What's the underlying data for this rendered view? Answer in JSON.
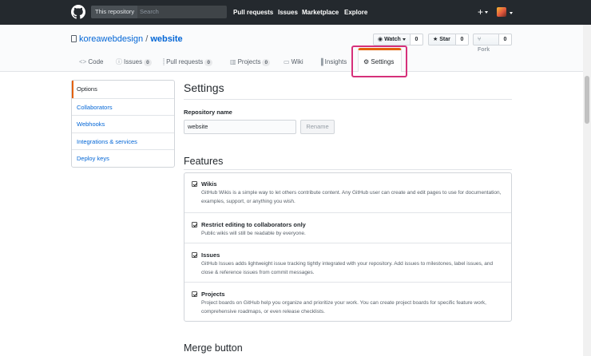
{
  "header": {
    "scope_label": "This repository",
    "search_placeholder": "Search",
    "nav": [
      "Pull requests",
      "Issues",
      "Marketplace",
      "Explore"
    ],
    "plus": "+"
  },
  "repo": {
    "owner": "koreawebdesign",
    "separator": "/",
    "name": "website",
    "watch_label": "Watch",
    "watch_count": "0",
    "star_label": "Star",
    "star_count": "0",
    "fork_label": "Fork",
    "fork_count": "0"
  },
  "tabs": {
    "code": "Code",
    "issues": "Issues",
    "issues_count": "0",
    "pulls": "Pull requests",
    "pulls_count": "0",
    "projects": "Projects",
    "projects_count": "0",
    "wiki": "Wiki",
    "insights": "Insights",
    "settings": "Settings"
  },
  "menu": [
    "Options",
    "Collaborators",
    "Webhooks",
    "Integrations & services",
    "Deploy keys"
  ],
  "main": {
    "title": "Settings",
    "repo_name_label": "Repository name",
    "repo_name_value": "website",
    "rename_label": "Rename",
    "features_title": "Features",
    "merge_title": "Merge button"
  },
  "features": [
    {
      "title": "Wikis",
      "desc": "GitHub Wikis is a simple way to let others contribute content. Any GitHub user can create and edit pages to use for documentation, examples, support, or anything you wish.",
      "checked": true
    },
    {
      "title": "Restrict editing to collaborators only",
      "desc": "Public wikis will still be readable by everyone.",
      "checked": true
    },
    {
      "title": "Issues",
      "desc": "GitHub Issues adds lightweight issue tracking tightly integrated with your repository. Add issues to milestones, label issues, and close & reference issues from commit messages.",
      "checked": true
    },
    {
      "title": "Projects",
      "desc": "Project boards on GitHub help you organize and prioritize your work. You can create project boards for specific feature work, comprehensive roadmaps, or even release checklists.",
      "checked": true
    }
  ],
  "colors": {
    "header_bg": "#24292e",
    "link": "#0366d6",
    "accent": "#e36209",
    "highlight": "#d6307a"
  }
}
